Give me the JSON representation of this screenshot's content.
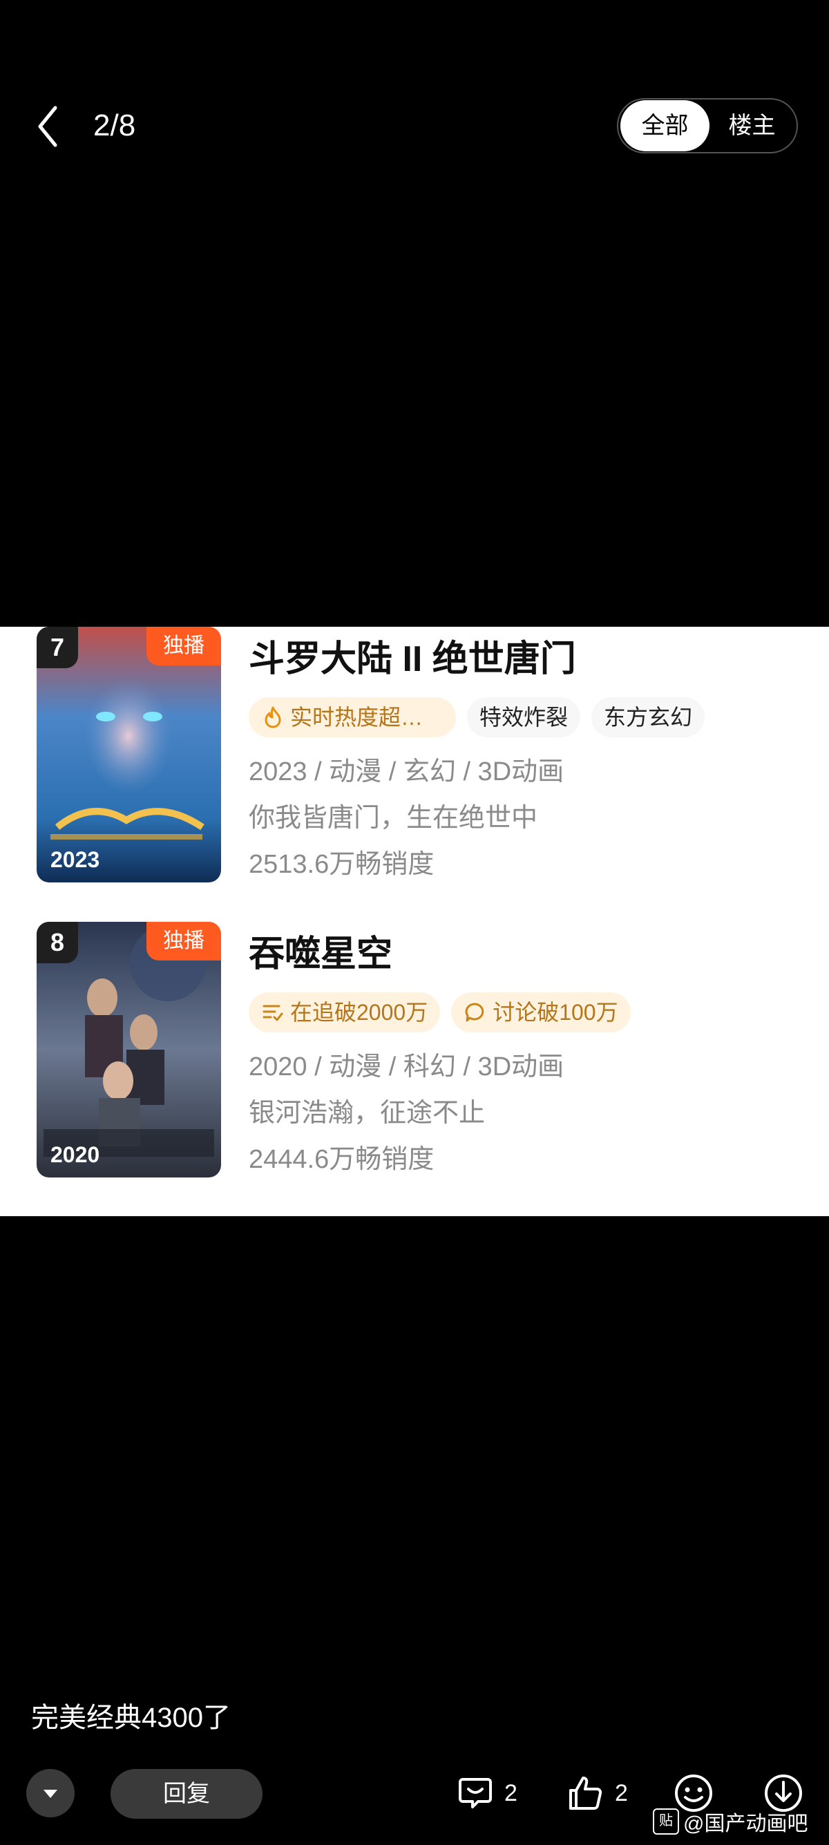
{
  "header": {
    "page_counter": "2/8",
    "filter_options": [
      "全部",
      "楼主"
    ],
    "selected_filter": "全部"
  },
  "items": [
    {
      "rank": "7",
      "badge": "独播",
      "poster_year": "2023",
      "title": "斗罗大陆 II 绝世唐门",
      "tags": [
        {
          "text": "实时热度超…",
          "icon": "flame-icon",
          "style": "gold"
        },
        {
          "text": "特效炸裂",
          "style": "plain"
        },
        {
          "text": "东方玄幻",
          "style": "plain"
        }
      ],
      "meta": "2023 / 动漫 / 玄幻 / 3D动画",
      "tagline": "你我皆唐门，生在绝世中",
      "sales": "2513.6万畅销度"
    },
    {
      "rank": "8",
      "badge": "独播",
      "poster_year": "2020",
      "title": "吞噬星空",
      "tags": [
        {
          "text": "在追破2000万",
          "icon": "list-icon",
          "style": "gold"
        },
        {
          "text": "讨论破100万",
          "icon": "chat-icon",
          "style": "gold"
        }
      ],
      "meta": "2020 / 动漫 / 科幻 / 3D动画",
      "tagline": "银河浩瀚，征途不止",
      "sales": "2444.6万畅销度"
    }
  ],
  "comment_text": "完美经典4300了",
  "bottom_bar": {
    "reply_label": "回复",
    "comment_count": "2",
    "like_count": "2"
  },
  "watermark": {
    "icon_text": "贴",
    "text": "@国产动画吧"
  },
  "colors": {
    "accent_orange": "#ff5a1f",
    "tag_gold_bg": "#fff3e0",
    "tag_gold_text": "#b5751b"
  }
}
